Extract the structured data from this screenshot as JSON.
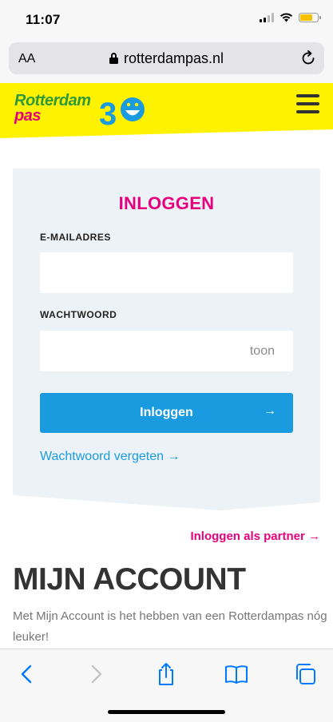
{
  "status_bar": {
    "time": "11:07"
  },
  "browser": {
    "aa_label": "AA",
    "url": "rotterdampas.nl"
  },
  "site": {
    "logo_line1": "Rotterdam",
    "logo_line2": "pas",
    "logo_badge": "30"
  },
  "login": {
    "title": "INLOGGEN",
    "email_label": "E-MAILADRES",
    "email_value": "",
    "password_label": "WACHTWOORD",
    "password_value": "",
    "show_password": "toon",
    "submit_label": "Inloggen",
    "submit_arrow": "→",
    "forgot_label": "Wachtwoord vergeten →"
  },
  "partner_link": "Inloggen als partner →",
  "account": {
    "heading": "MIJN ACCOUNT",
    "text": "Met Mijn Account is het hebben van een Rotterdampas nóg leuker!"
  },
  "colors": {
    "brand_yellow": "#fff200",
    "brand_magenta": "#e5007e",
    "brand_green": "#2f9a3b",
    "accent_blue": "#1a9be0",
    "card_bg": "#edf2f6",
    "ios_blue": "#007aff"
  },
  "icons": {
    "lock": "lock-icon",
    "reload": "reload-icon",
    "menu": "hamburger-menu-icon",
    "back": "chevron-left-icon",
    "forward": "chevron-right-icon",
    "share": "share-icon",
    "bookmarks": "book-icon",
    "tabs": "tabs-icon"
  }
}
